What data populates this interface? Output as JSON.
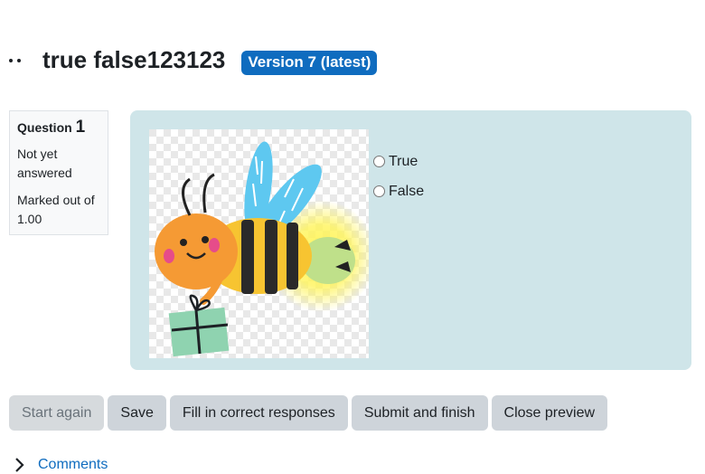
{
  "header": {
    "drag_icon": "drag-handle-icon",
    "title": "true false123123",
    "version_badge": "Version 7 (latest)"
  },
  "question_info": {
    "question_label": "Question",
    "question_number": "1",
    "status": "Not yet answered",
    "marks": "Marked out of 1.00"
  },
  "question": {
    "image": "bee-illustration",
    "answers": [
      {
        "label": "True",
        "selected": false
      },
      {
        "label": "False",
        "selected": false
      }
    ]
  },
  "actions": {
    "start_again": "Start again",
    "save": "Save",
    "fill_correct": "Fill in correct responses",
    "submit_finish": "Submit and finish",
    "close_preview": "Close preview"
  },
  "comments": {
    "label": "Comments",
    "icon": "chevron-right-icon"
  },
  "colors": {
    "accent": "#0f6cbf",
    "panel_bg": "#cfe5e9",
    "button_bg": "#ced4da"
  }
}
